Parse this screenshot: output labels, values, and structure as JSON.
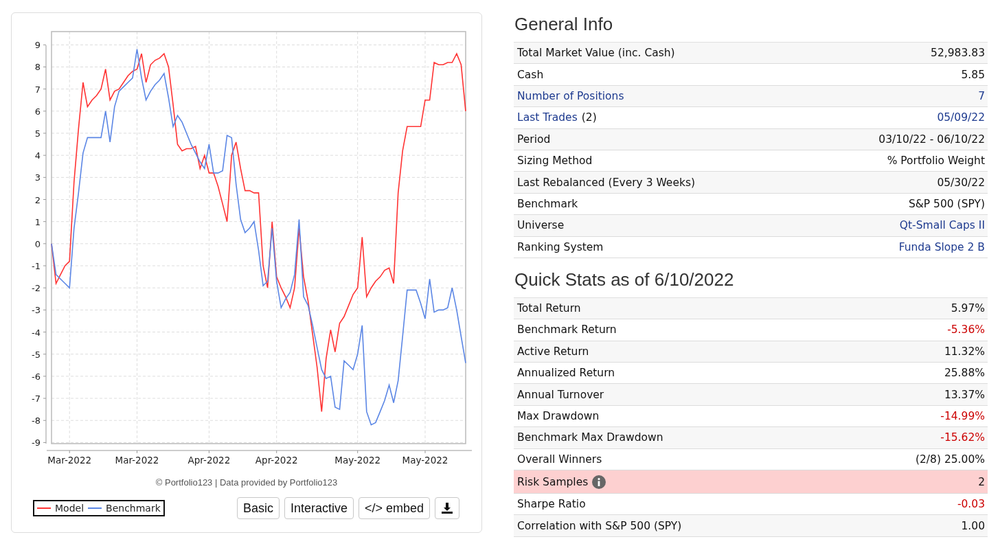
{
  "chart": {
    "chart_data": {
      "type": "line",
      "grid": true,
      "ylim": [
        -9.05,
        9.6
      ],
      "yticks": [
        -9,
        -8,
        -7,
        -6,
        -5,
        -4,
        -3,
        -2,
        -1,
        0,
        1,
        2,
        3,
        4,
        5,
        6,
        7,
        8,
        9
      ],
      "categories": [
        null,
        null,
        null,
        null,
        "Mar-2022",
        null,
        null,
        null,
        null,
        null,
        null,
        null,
        null,
        null,
        null,
        null,
        null,
        null,
        null,
        "Mar-2022",
        null,
        null,
        null,
        null,
        null,
        null,
        null,
        null,
        null,
        null,
        null,
        null,
        null,
        null,
        null,
        "Apr-2022",
        null,
        null,
        null,
        null,
        null,
        null,
        null,
        null,
        null,
        null,
        null,
        null,
        null,
        null,
        "Apr-2022",
        null,
        null,
        null,
        null,
        null,
        null,
        null,
        null,
        null,
        null,
        null,
        null,
        null,
        null,
        null,
        null,
        null,
        "May-2022",
        null,
        null,
        null,
        null,
        null,
        null,
        null,
        null,
        null,
        null,
        null,
        null,
        null,
        null,
        "May-2022",
        null,
        null,
        null,
        null,
        null,
        null,
        null,
        null,
        null
      ],
      "series": [
        {
          "name": "Model",
          "color": "#ff3333",
          "values": [
            0,
            -1.8,
            -1.4,
            -1.0,
            -0.8,
            2.8,
            5.2,
            7.3,
            6.2,
            6.5,
            6.7,
            7.0,
            7.9,
            6.5,
            6.9,
            7.0,
            7.3,
            7.6,
            7.8,
            7.9,
            8.6,
            7.3,
            8.1,
            8.3,
            8.4,
            8.6,
            8.0,
            6.3,
            4.5,
            4.2,
            4.3,
            4.3,
            4.4,
            3.4,
            4.0,
            3.2,
            3.2,
            2.6,
            1.8,
            1.0,
            4.0,
            4.6,
            3.4,
            2.4,
            2.4,
            2.3,
            2.3,
            -1.0,
            -2.0,
            1.0,
            -1.5,
            -2.0,
            -2.4,
            -2.9,
            -2.0,
            0.7,
            -1.5,
            -2.6,
            -4.1,
            -5.6,
            -7.6,
            -5.2,
            -3.9,
            -4.9,
            -3.6,
            -3.3,
            -2.8,
            -2.3,
            -2.0,
            0.3,
            -2.4,
            -2.0,
            -1.7,
            -1.5,
            -1.2,
            -1.1,
            -1.8,
            2.3,
            4.2,
            5.3,
            5.3,
            5.3,
            5.3,
            6.5,
            6.5,
            8.2,
            8.1,
            8.1,
            8.2,
            8.2,
            8.6,
            8.1,
            6.0
          ]
        },
        {
          "name": "Benchmark",
          "color": "#5b86e5",
          "values": [
            0,
            -1.4,
            -1.6,
            -1.8,
            -2.0,
            0.7,
            2.3,
            4.1,
            4.8,
            4.8,
            4.8,
            4.8,
            6.0,
            4.6,
            6.2,
            6.9,
            7.1,
            7.3,
            7.5,
            8.8,
            7.5,
            6.5,
            6.9,
            7.2,
            7.4,
            7.7,
            6.6,
            5.3,
            5.8,
            5.5,
            5.0,
            4.5,
            4.1,
            3.7,
            3.4,
            4.5,
            3.2,
            3.2,
            3.3,
            4.9,
            4.8,
            2.7,
            1.1,
            0.5,
            0.7,
            1.0,
            -0.3,
            -1.9,
            -1.7,
            0.7,
            -1.7,
            -2.9,
            -2.5,
            -2.2,
            -1.4,
            1.1,
            -2.4,
            -2.8,
            -3.7,
            -4.7,
            -5.7,
            -6.1,
            -6.0,
            -7.4,
            -7.5,
            -5.3,
            -5.5,
            -5.7,
            -5.0,
            -3.7,
            -7.6,
            -8.2,
            -8.1,
            -7.6,
            -7.1,
            -6.4,
            -7.2,
            -6.2,
            -4.2,
            -2.1,
            -2.1,
            -2.1,
            -2.7,
            -3.4,
            -1.6,
            -3.1,
            -3.0,
            -3.0,
            -2.9,
            -2.0,
            -3.0,
            -4.2,
            -5.4
          ]
        }
      ]
    },
    "credit": "© Portfolio123 | Data provided by Portfolio123",
    "buttons": [
      {
        "kind": "text",
        "label": "Basic"
      },
      {
        "kind": "text",
        "label": "Interactive"
      },
      {
        "kind": "text",
        "label": "</> embed"
      },
      {
        "kind": "download"
      }
    ]
  },
  "general_info": {
    "title": "General Info",
    "rows": [
      {
        "label": "Total Market Value (inc. Cash)",
        "label_link": false,
        "value": "52,983.83",
        "value_link": false,
        "negative": false,
        "info": false,
        "highlighted": false
      },
      {
        "label": "Cash",
        "label_link": false,
        "value": "5.85",
        "value_link": false,
        "negative": false,
        "info": false,
        "highlighted": false
      },
      {
        "label": "Number of Positions",
        "label_link": true,
        "value": "7",
        "value_link": true,
        "negative": false,
        "info": false,
        "highlighted": false
      },
      {
        "label": "Last Trades",
        "label_link": true,
        "label_note": "(2)",
        "value": "05/09/22",
        "value_link": true,
        "negative": false,
        "info": false,
        "highlighted": false
      },
      {
        "label": "Period",
        "label_link": false,
        "value": "03/10/22 - 06/10/22",
        "value_link": false,
        "negative": false,
        "info": false,
        "highlighted": false
      },
      {
        "label": "Sizing Method",
        "label_link": false,
        "value": "% Portfolio Weight",
        "value_link": false,
        "negative": false,
        "info": false,
        "highlighted": false
      },
      {
        "label": "Last Rebalanced (Every 3 Weeks)",
        "label_link": false,
        "value": "05/30/22",
        "value_link": false,
        "negative": false,
        "info": false,
        "highlighted": false
      },
      {
        "label": "Benchmark",
        "label_link": false,
        "value": "S&P 500 (SPY)",
        "value_link": false,
        "negative": false,
        "info": false,
        "highlighted": false
      },
      {
        "label": "Universe",
        "label_link": false,
        "value": "Qt-Small Caps II",
        "value_link": true,
        "negative": false,
        "info": false,
        "highlighted": false
      },
      {
        "label": "Ranking System",
        "label_link": false,
        "value": "Funda Slope 2 B",
        "value_link": true,
        "negative": false,
        "info": false,
        "highlighted": false
      }
    ]
  },
  "quick_stats": {
    "title": "Quick Stats as of 6/10/2022",
    "rows": [
      {
        "label": "Total Return",
        "label_link": false,
        "value": "5.97%",
        "value_link": false,
        "negative": false,
        "info": false,
        "highlighted": false
      },
      {
        "label": "Benchmark Return",
        "label_link": false,
        "value": "-5.36%",
        "value_link": false,
        "negative": true,
        "info": false,
        "highlighted": false
      },
      {
        "label": "Active Return",
        "label_link": false,
        "value": "11.32%",
        "value_link": false,
        "negative": false,
        "info": false,
        "highlighted": false
      },
      {
        "label": "Annualized Return",
        "label_link": false,
        "value": "25.88%",
        "value_link": false,
        "negative": false,
        "info": false,
        "highlighted": false
      },
      {
        "label": "Annual Turnover",
        "label_link": false,
        "value": "13.37%",
        "value_link": false,
        "negative": false,
        "info": false,
        "highlighted": false
      },
      {
        "label": "Max Drawdown",
        "label_link": false,
        "value": "-14.99%",
        "value_link": false,
        "negative": true,
        "info": false,
        "highlighted": false
      },
      {
        "label": "Benchmark Max Drawdown",
        "label_link": false,
        "value": "-15.62%",
        "value_link": false,
        "negative": true,
        "info": false,
        "highlighted": false
      },
      {
        "label": "Overall Winners",
        "label_link": false,
        "value": "(2/8) 25.00%",
        "value_link": false,
        "negative": false,
        "info": false,
        "highlighted": false
      },
      {
        "label": "Risk Samples",
        "label_link": false,
        "value": "2",
        "value_link": false,
        "negative": false,
        "info": true,
        "highlighted": true
      },
      {
        "label": "Sharpe Ratio",
        "label_link": false,
        "value": "-0.03",
        "value_link": false,
        "negative": true,
        "info": false,
        "highlighted": false
      },
      {
        "label": "Correlation with S&P 500 (SPY)",
        "label_link": false,
        "value": "1.00",
        "value_link": false,
        "negative": false,
        "info": false,
        "highlighted": false
      }
    ]
  }
}
